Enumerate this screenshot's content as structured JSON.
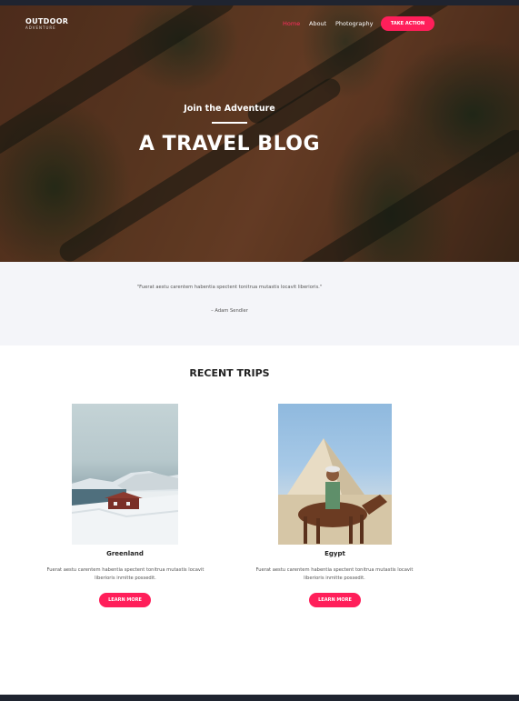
{
  "header": {
    "logo_line1": "OUTDOOR",
    "logo_line2": "ADVENTURE",
    "nav": [
      "Home",
      "About",
      "Photography"
    ],
    "cta": "TAKE ACTION"
  },
  "hero": {
    "subtitle": "Join the Adventure",
    "title": "A TRAVEL BLOG"
  },
  "quote": {
    "text": "\"Fuerat aestu carentem habentia spectent tonitrua mutastis locavit liberioris.\"",
    "author": "– Adam Sendler"
  },
  "trips": {
    "heading": "RECENT TRIPS",
    "items": [
      {
        "title": "Greenland",
        "text_line1": "Fuerat aestu carentem habentia spectent tonitrua mutastis locavit",
        "text_line2": "liberioris inmitte possedit.",
        "button": "LEARN MORE"
      },
      {
        "title": "Egypt",
        "text_line1": "Fuerat aestu carentem habentia spectent tonitrua mutastis locavit",
        "text_line2": "liberioris inmitte possedit.",
        "button": "LEARN MORE"
      }
    ]
  },
  "colors": {
    "accent": "#ff1f5a",
    "nav_active": "#ff2d5f",
    "dark": "#1f2430",
    "quote_bg": "#f4f5f9"
  }
}
